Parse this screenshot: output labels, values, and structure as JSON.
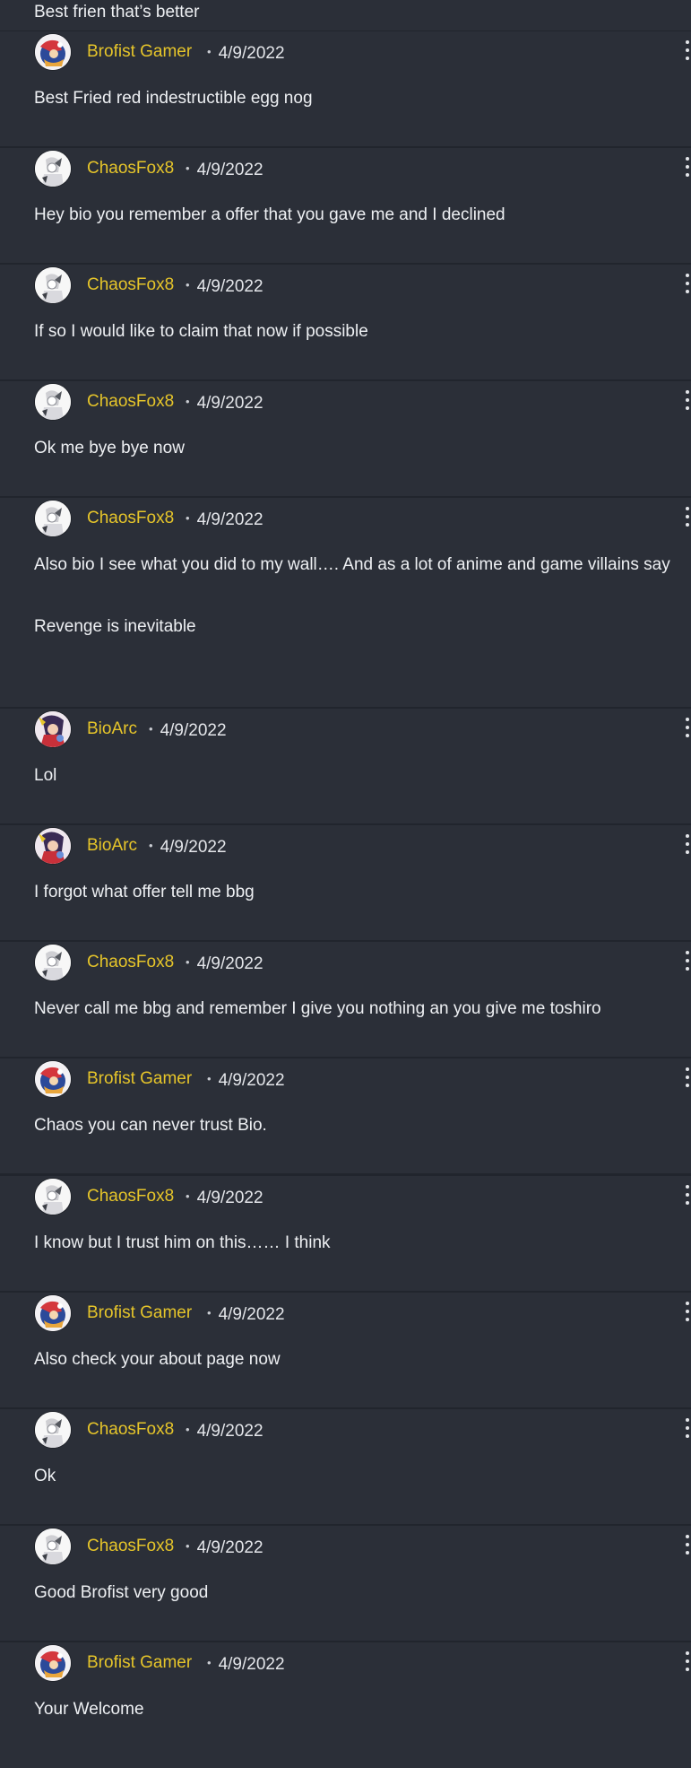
{
  "comments": [
    {
      "user": "",
      "date": "",
      "text": [
        "Best frien that’s better"
      ],
      "avatar": "",
      "partial": true
    },
    {
      "user": "Brofist Gamer",
      "date": "4/9/2022",
      "avatar": "brofist",
      "text": [
        "Best Fried red indestructible egg nog"
      ]
    },
    {
      "user": "ChaosFox8",
      "date": "4/9/2022",
      "avatar": "chaos",
      "text": [
        "Hey bio you remember a offer that you gave me and I declined"
      ]
    },
    {
      "user": "ChaosFox8",
      "date": "4/9/2022",
      "avatar": "chaos",
      "text": [
        "If so I would like to claim that now if possible"
      ]
    },
    {
      "user": "ChaosFox8",
      "date": "4/9/2022",
      "avatar": "chaos",
      "text": [
        "Ok me bye bye now"
      ]
    },
    {
      "user": "ChaosFox8",
      "date": "4/9/2022",
      "avatar": "chaos",
      "text": [
        "Also bio I see what you did to my wall…. And as a lot of anime and game villains say",
        "Revenge is inevitable"
      ]
    },
    {
      "user": "BioArc",
      "date": "4/9/2022",
      "avatar": "bioarc",
      "text": [
        "Lol"
      ]
    },
    {
      "user": "BioArc",
      "date": "4/9/2022",
      "avatar": "bioarc",
      "text": [
        "I forgot what offer tell me bbg"
      ]
    },
    {
      "user": "ChaosFox8",
      "date": "4/9/2022",
      "avatar": "chaos",
      "text": [
        "Never call me bbg and remember I give you nothing an you give me toshiro"
      ]
    },
    {
      "user": "Brofist Gamer",
      "date": "4/9/2022",
      "avatar": "brofist",
      "text": [
        "Chaos you can never trust Bio."
      ]
    },
    {
      "user": "ChaosFox8",
      "date": "4/9/2022",
      "avatar": "chaos",
      "text": [
        "I know but I trust him on this…… I think"
      ]
    },
    {
      "user": "Brofist Gamer",
      "date": "4/9/2022",
      "avatar": "brofist",
      "text": [
        "Also check your about page now"
      ]
    },
    {
      "user": "ChaosFox8",
      "date": "4/9/2022",
      "avatar": "chaos",
      "text": [
        "Ok"
      ]
    },
    {
      "user": "ChaosFox8",
      "date": "4/9/2022",
      "avatar": "chaos",
      "text": [
        "Good Brofist very good"
      ]
    },
    {
      "user": "Brofist Gamer",
      "date": "4/9/2022",
      "avatar": "brofist",
      "text": [
        "Your Welcome"
      ]
    }
  ],
  "icons": {
    "more": "kebab-menu-icon",
    "separator": "•"
  },
  "colors": {
    "background": "#21252d",
    "card": "#2b2f38",
    "username": "#e6c52a",
    "text": "#e4e6ea"
  }
}
